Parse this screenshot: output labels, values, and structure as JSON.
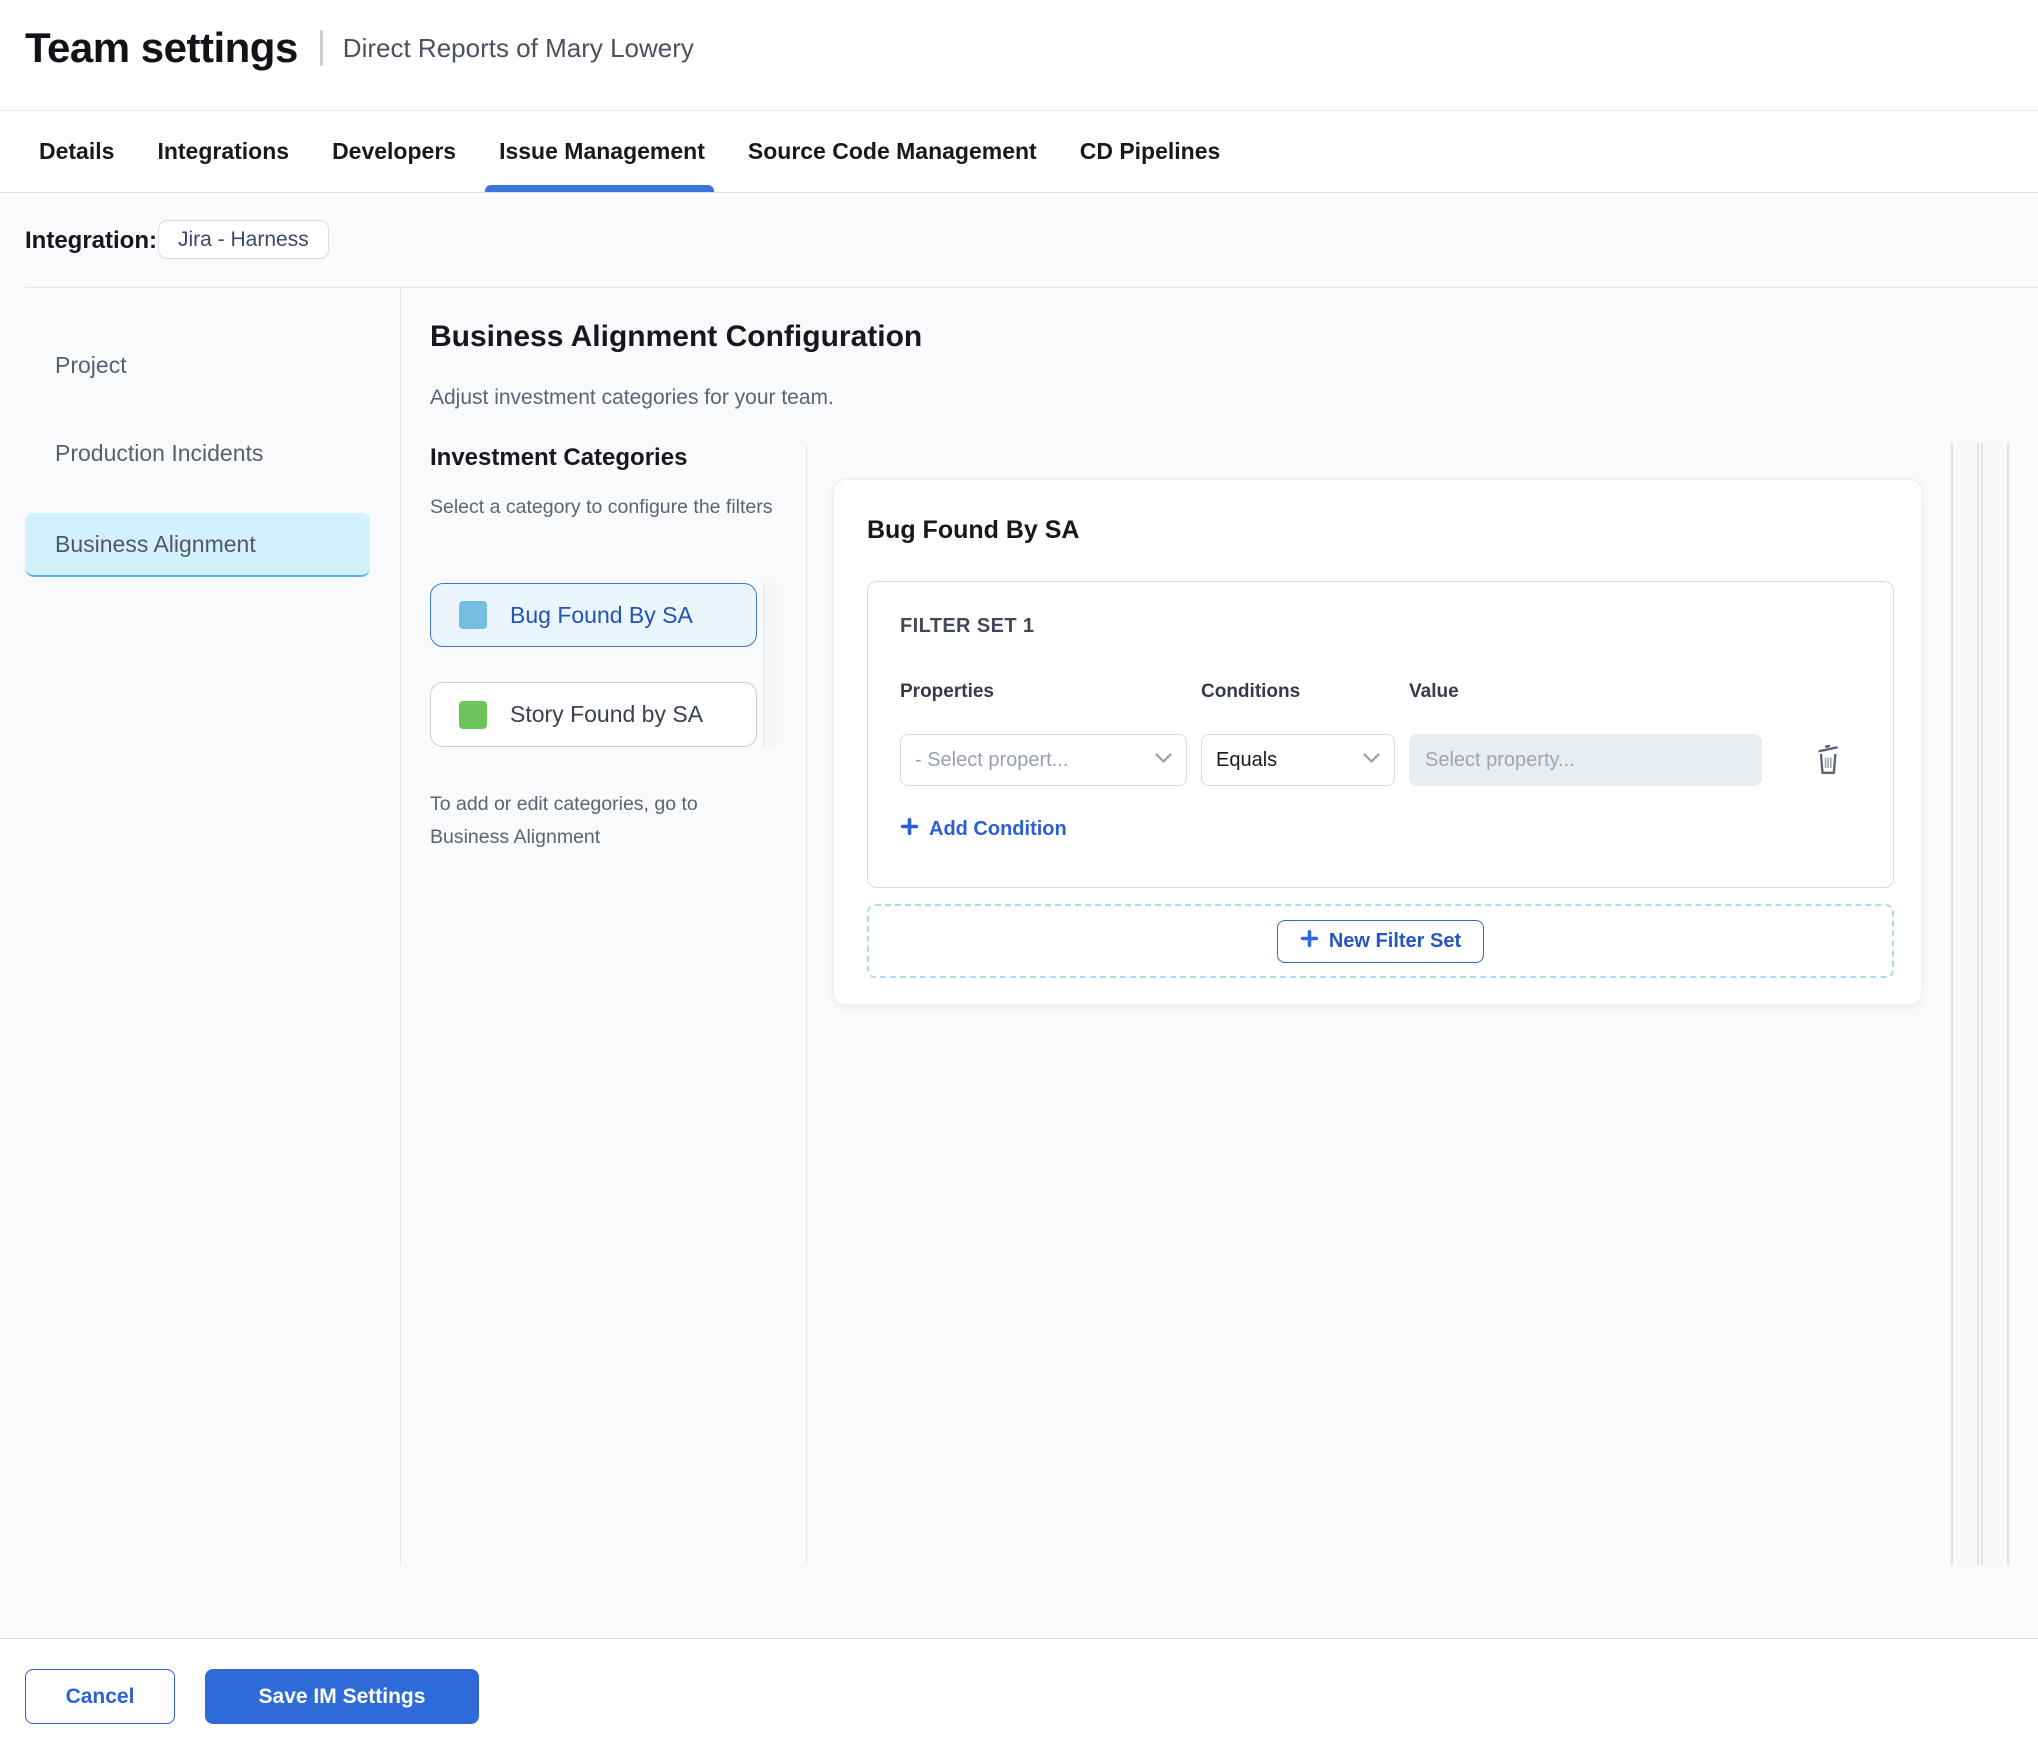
{
  "header": {
    "title": "Team settings",
    "subtitle": "Direct Reports of Mary Lowery"
  },
  "tabs": {
    "items": [
      {
        "label": "Details",
        "active": false
      },
      {
        "label": "Integrations",
        "active": false
      },
      {
        "label": "Developers",
        "active": false
      },
      {
        "label": "Issue Management",
        "active": true
      },
      {
        "label": "Source Code Management",
        "active": false
      },
      {
        "label": "CD Pipelines",
        "active": false
      }
    ]
  },
  "integration": {
    "label": "Integration:",
    "chip": "Jira - Harness"
  },
  "sidebar": {
    "items": [
      {
        "label": "Project",
        "active": false
      },
      {
        "label": "Production Incidents",
        "active": false
      },
      {
        "label": "Business Alignment",
        "active": true
      }
    ]
  },
  "main": {
    "title": "Business Alignment Configuration",
    "subtitle": "Adjust investment categories for your team.",
    "categories_panel": {
      "title": "Investment Categories",
      "hint": "Select a category to configure the filters",
      "items": [
        {
          "label": "Bug Found By SA",
          "swatch_color": "#74bfdf",
          "selected": true
        },
        {
          "label": "Story Found by SA",
          "swatch_color": "#6dc35c",
          "selected": false
        }
      ],
      "note": "To add or edit categories, go to Business Alignment"
    },
    "config_card": {
      "title": "Bug Found By SA",
      "filter_set": {
        "title": "FILTER SET 1",
        "columns": {
          "properties": "Properties",
          "conditions": "Conditions",
          "value": "Value"
        },
        "property_placeholder": "- Select propert...",
        "condition_selected": "Equals",
        "value_placeholder": "Select property...",
        "add_condition_label": "Add Condition"
      },
      "new_filter_set_label": "New Filter Set"
    }
  },
  "footer": {
    "cancel_label": "Cancel",
    "save_label": "Save IM Settings"
  },
  "colors": {
    "primary_blue": "#2e6bd8",
    "active_tab_underline": "#3b74dd",
    "sidebar_active_bg": "#d2f1fb",
    "sidebar_active_border": "#54b5e5",
    "selected_category_bg": "#ebf5fd",
    "selected_category_border": "#3f76cf",
    "bug_swatch": "#74bfdf",
    "story_swatch": "#6dc35c"
  }
}
